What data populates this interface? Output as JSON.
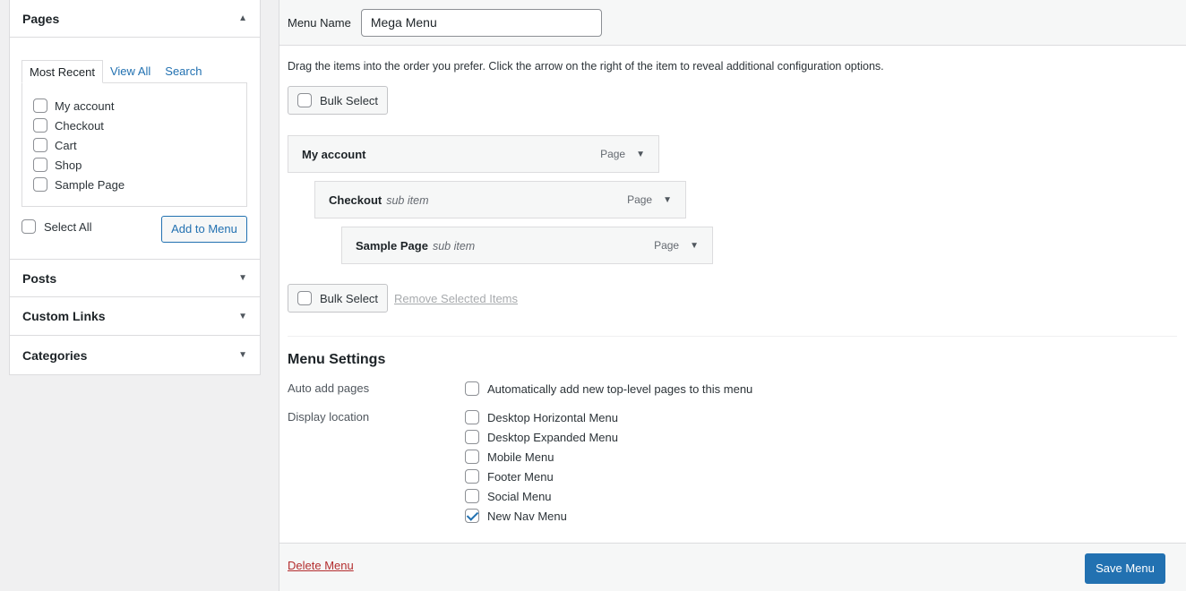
{
  "left_panel": {
    "pages": {
      "title": "Pages",
      "arrow": "▲",
      "tabs": [
        {
          "label": "Most Recent"
        },
        {
          "label": "View All"
        },
        {
          "label": "Search"
        }
      ],
      "items": [
        {
          "label": "My account",
          "checked": false
        },
        {
          "label": "Checkout",
          "checked": false
        },
        {
          "label": "Cart",
          "checked": false
        },
        {
          "label": "Shop",
          "checked": false
        },
        {
          "label": "Sample Page",
          "checked": false
        }
      ],
      "select_all_label": "Select All",
      "add_button_label": "Add to Menu"
    },
    "posts": {
      "title": "Posts",
      "arrow": "▼"
    },
    "custom_links": {
      "title": "Custom Links",
      "arrow": "▼"
    },
    "categories": {
      "title": "Categories",
      "arrow": "▼"
    }
  },
  "right_panel": {
    "menu_name_label": "Menu Name",
    "menu_name_value": "Mega Menu",
    "instructions": "Drag the items into the order you prefer. Click the arrow on the right of the item to reveal additional configuration options.",
    "bulk_select_label": "Bulk Select",
    "remove_selected_label": "Remove Selected Items",
    "menu_items": [
      {
        "title": "My account",
        "sub": "",
        "type": "Page",
        "arrow": "▼"
      },
      {
        "title": "Checkout",
        "sub": "sub item",
        "type": "Page",
        "arrow": "▼"
      },
      {
        "title": "Sample Page",
        "sub": "sub item",
        "type": "Page",
        "arrow": "▼"
      }
    ],
    "settings": {
      "title": "Menu Settings",
      "auto_add_label": "Auto add pages",
      "auto_add_option": {
        "label": "Automatically add new top-level pages to this menu",
        "checked": false
      },
      "display_location_label": "Display location",
      "locations": [
        {
          "label": "Desktop Horizontal Menu",
          "checked": false
        },
        {
          "label": "Desktop Expanded Menu",
          "checked": false
        },
        {
          "label": "Mobile Menu",
          "checked": false
        },
        {
          "label": "Footer Menu",
          "checked": false
        },
        {
          "label": "Social Menu",
          "checked": false
        },
        {
          "label": "New Nav Menu",
          "checked": true
        }
      ]
    },
    "footer": {
      "delete_label": "Delete Menu",
      "save_label": "Save Menu"
    }
  }
}
